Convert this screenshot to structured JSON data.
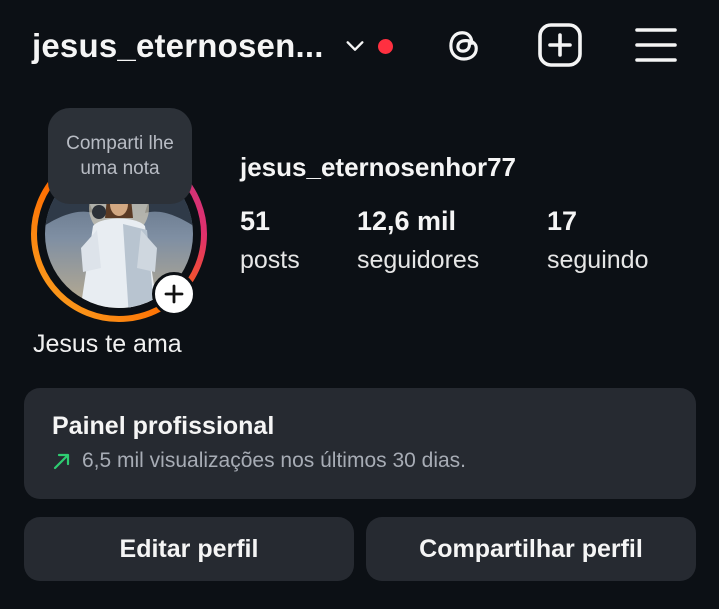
{
  "header": {
    "username": "jesus_eternosen...",
    "notification_dot_color": "#ff3040",
    "icons": [
      "chevron-down-icon",
      "threads-icon",
      "create-plus-icon",
      "menu-icon"
    ]
  },
  "profile": {
    "note_text": "Comparti lhe uma nota",
    "display_name": "Jesus te ama",
    "username": "jesus_eternosenhor77",
    "stats": {
      "posts": {
        "value": "51",
        "label": "posts"
      },
      "followers": {
        "value": "12,6 mil",
        "label": "seguidores"
      },
      "following": {
        "value": "17",
        "label": "seguindo"
      }
    },
    "story_ring_colors": [
      "#f9a825",
      "#ff6b00",
      "#e1306c",
      "#c13584"
    ]
  },
  "professional_panel": {
    "title": "Painel profissional",
    "subtitle": "6,5 mil visualizações nos últimos 30 dias.",
    "trend_color": "#2ecc71"
  },
  "actions": {
    "edit_label": "Editar perfil",
    "share_label": "Compartilhar perfil"
  }
}
